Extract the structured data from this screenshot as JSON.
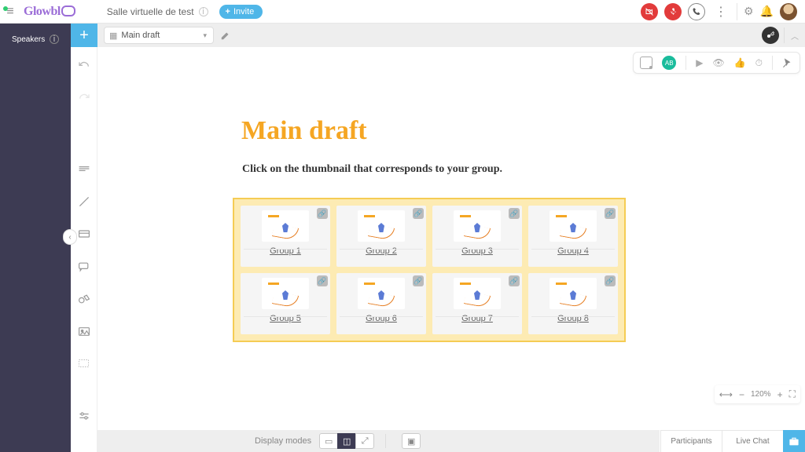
{
  "header": {
    "logo": "Glowbl",
    "room_title": "Salle virtuelle de test",
    "invite_label": "Invite"
  },
  "speakers": {
    "label": "Speakers"
  },
  "tab": {
    "name": "Main draft"
  },
  "canvas": {
    "title": "Main draft",
    "subtitle": "Click on the thumbnail that corresponds to your group."
  },
  "panel": {
    "badge": "AB"
  },
  "groups": [
    {
      "label": "Group 1"
    },
    {
      "label": "Group 2"
    },
    {
      "label": "Group 3"
    },
    {
      "label": "Group 4"
    },
    {
      "label": "Group 5"
    },
    {
      "label": "Group 6"
    },
    {
      "label": "Group 7"
    },
    {
      "label": "Group 8"
    }
  ],
  "bottom": {
    "display_modes": "Display modes",
    "zoom_pct": "120%",
    "participants": "Participants",
    "live_chat": "Live Chat"
  },
  "icons": {
    "link": "🔗",
    "gear": "⚙",
    "bell": "🔔",
    "play": "▶",
    "eye": "👁",
    "thumbs": "👍",
    "timer": "⏱"
  }
}
